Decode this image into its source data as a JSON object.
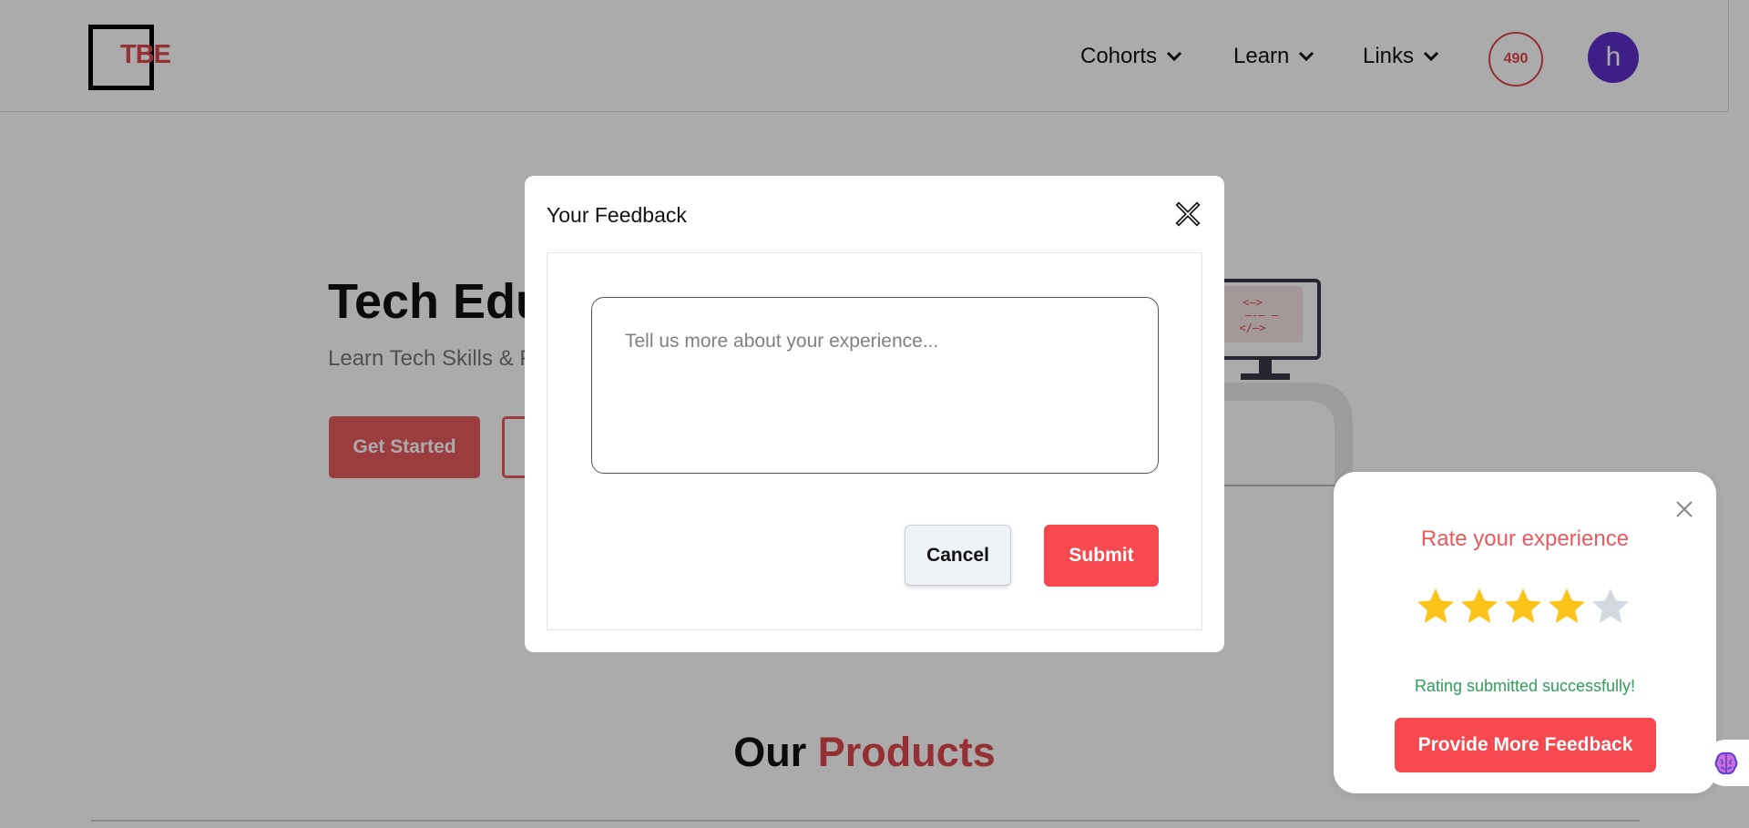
{
  "header": {
    "logo_text": "TBE",
    "nav": [
      {
        "label": "Cohorts"
      },
      {
        "label": "Learn"
      },
      {
        "label": "Links"
      }
    ],
    "points": "490",
    "avatar_initial": "h"
  },
  "hero": {
    "title": "Tech Education",
    "subtitle": "Learn Tech Skills & Practice",
    "get_started_label": "Get Started"
  },
  "products": {
    "heading_part1": "Our",
    "heading_part2": "Products"
  },
  "feedback_modal": {
    "title": "Your Feedback",
    "textarea_placeholder": "Tell us more about your experience...",
    "textarea_value": "",
    "cancel_label": "Cancel",
    "submit_label": "Submit"
  },
  "rating_widget": {
    "title": "Rate your experience",
    "rating": 4,
    "max_rating": 5,
    "status_message": "Rating submitted successfully!",
    "more_feedback_label": "Provide More Feedback"
  },
  "colors": {
    "accent": "#e0474c",
    "button_red": "#f5484f",
    "star_filled": "#fcc419",
    "star_empty": "#d3d7de",
    "success": "#2f9e5a",
    "avatar_bg": "#5b2fc9"
  },
  "icons": {
    "close": "close-x-icon",
    "chevron": "chevron-down-icon",
    "star": "star-icon",
    "brain": "brain-icon"
  }
}
